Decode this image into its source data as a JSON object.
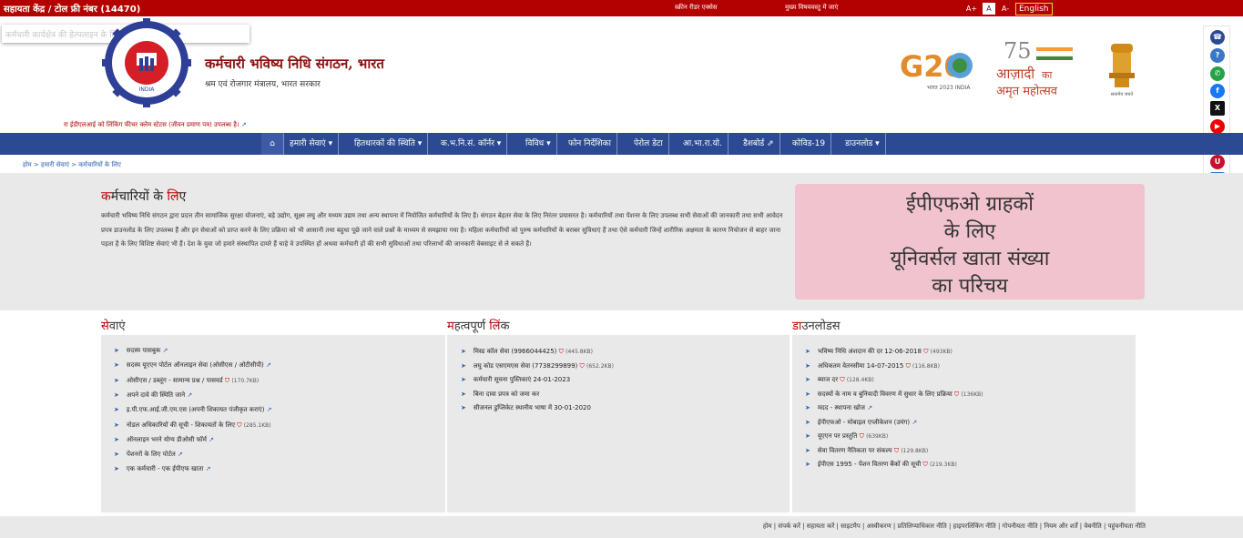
{
  "topbar": {
    "helpline": "सहायता केंद्र / टोल फ्री नंबर (14470)",
    "screen_reader": "स्क्रीन रीडर एक्सेस",
    "skip_to_main": "मुख्य विषयवस्तु में जाएं",
    "font_increase": "A+",
    "font_normal": "A",
    "font_decrease": "A-",
    "language": "English"
  },
  "header": {
    "skip_box_text": "कर्मचारी कार्यक्षेत्र की हेल्पलाइन के लिए यहाँ क्लिक करें",
    "org_title": "कर्मचारी भविष्य निधि संगठन, भारत",
    "org_subtitle": "श्रम एवं रोजगार मंत्रालय, भारत सरकार",
    "fraud_note": "रा ईडीएलआई को लिंकिंग फीचर क्लेम स्टेटस (जीवन प्रमाण पत्र) उपलब्ध है।",
    "logo_text_inner": "INDIA",
    "g20_label": "G20",
    "g20_sub": "भारत 2023 INDIA",
    "azadi_top": "75",
    "azadi_line1": "आज़ादी",
    "azadi_ka": "का",
    "azadi_line2": "अमृत महोत्सव",
    "emblem_caption": "सत्यमेव जयते"
  },
  "social": [
    "phone-icon",
    "faq-icon",
    "whatsapp-icon",
    "facebook-icon",
    "x-icon",
    "youtube-icon",
    "call-icon",
    "umang-icon",
    "document-icon",
    "app-icon",
    "instagram-icon",
    "koo-icon"
  ],
  "nav": {
    "home": "⌂",
    "items": [
      "हमारी सेवाएं ▾",
      "हितधारकों की स्थिति ▾",
      "क.भ.नि.सं. कॉर्नर ▾",
      "विविध ▾",
      "फोन निर्देशिका",
      "पेरोल डेटा",
      "आ.भा.रा.यो.",
      "डैशबोर्ड ⇗",
      "कोविड-19",
      "डाउनलोड ▾"
    ]
  },
  "breadcrumb": "होम > हमारी सेवाएं > कर्मचारियों के लिए",
  "intro": {
    "title_a": "क",
    "title_b": "र्मचारियों के ",
    "title_c": "लि",
    "title_d": "ए",
    "text": "कर्मचारी भविष्य निधि संगठन द्वारा प्रदत्त तीन सामाजिक सुरक्षा योजनाएं, बड़े उद्योग, सूक्ष्म लघु और मध्यम उद्यम तथा अन्य स्थापना में नियोजित कर्मचारियों के लिए हैं। संगठन बेहतर सेवा के लिए निरंतर प्रयासरत है। कर्मचारियों तथा पेंशनर के लिए उपलब्ध सभी सेवाओं की जानकारी तथा सभी आवेदन प्रपत्र डाउनलोड के लिए उपलब्ध हैं और इन सेवाओं को प्राप्त करने के लिए प्रक्रिया को भी आसानी तथा बहुधा पूछे जाने वाले प्रश्नों के माध्यम से समझाया गया है। महिला कर्मचारियों को पुरुष कर्मचारियों के बराबर सुविधाएं हैं तथा ऐसे कर्मचारी जिन्हें शारीरिक अक्षमता के कारण नियोजन से बाहर जाना पड़ता है के लिए विशिष्ट सेवाएं भी हैं। देश के युवा जो हमारे संस्थापित दायरे हैं चाहे वे उपस्थित हों अथवा कर्मचारी हों की सभी सुविधाओं तथा परिलाभों की जानकारी वेबसाइट से ले सकते हैं।",
    "banner_lines": [
      "ईपीएफओ ग्राहकों",
      "के लिए",
      "यूनिवर्सल खाता संख्या",
      "का परिचय"
    ]
  },
  "services": {
    "title_a": "से",
    "title_b": "वाएं",
    "items": [
      {
        "label": "सदस्य पासबुक",
        "size": "",
        "icon": "ext"
      },
      {
        "label": "सदस्य यूएएन पोर्टल ऑनलाइन सेवा (ओसीएस / ओटीसीपी)",
        "size": "",
        "icon": "ext"
      },
      {
        "label": "ओसीएस / डब्लूंग - सामान्य प्रश्न / पासवर्ड",
        "size": "(170.7KB)",
        "icon": "pdf"
      },
      {
        "label": "अपने दावे की स्थिति जाने",
        "size": "",
        "icon": "ext"
      },
      {
        "label": "इ.पी.एफ.आई.जी.एम.एस (अपनी शिकायत पंजीकृत कराएं)",
        "size": "",
        "icon": "ext"
      },
      {
        "label": "नोडल अधिकारियों की सूची - शिकायतों के लिए",
        "size": "(285.1KB)",
        "icon": "pdf"
      },
      {
        "label": "ऑनलाइन भरने योग्य डीओसी फॉर्म",
        "size": "",
        "icon": "ext"
      },
      {
        "label": "पेंशनरों के लिए पोर्टल",
        "size": "",
        "icon": "ext"
      },
      {
        "label": "एक कर्मचारी - एक ईपीएफ खाता",
        "size": "",
        "icon": "ext"
      }
    ]
  },
  "important_links": {
    "title_a": "म",
    "title_b": "हत्वपूर्ण ",
    "title_c": "लिं",
    "title_d": "क",
    "items": [
      {
        "label": "मिस्ड कॉल सेवा (9966044425)",
        "size": "(445.8KB)",
        "icon": "pdf"
      },
      {
        "label": "लघु कोड एसएमएस सेवा (7738299899)",
        "size": "(652.2KB)",
        "icon": "pdf"
      },
      {
        "label": "कर्मचारी सूचना पुस्तिकाएं 24-01-2023",
        "size": "",
        "icon": ""
      },
      {
        "label": "बिना दावा प्रपत्र को जमा कर",
        "size": "",
        "icon": ""
      },
      {
        "label": "सीजनल डुप्लिकेट स्थानीय भाषा में 30-01-2020",
        "size": "",
        "icon": ""
      }
    ]
  },
  "downloads": {
    "title_a": "डा",
    "title_b": "उनलोडस",
    "items": [
      {
        "label": "भविष्य निधि अंशदान की दर 12-06-2018",
        "size": "(493KB)",
        "icon": "pdf"
      },
      {
        "label": "अधिकतम वेतनसीमा 14-07-2015",
        "size": "(116.8KB)",
        "icon": "pdf"
      },
      {
        "label": "ब्याज दर",
        "size": "(128.4KB)",
        "icon": "pdf"
      },
      {
        "label": "सदस्यों के नाम व बुनियादी विवरण में सुधार के लिए प्रक्रिया",
        "size": "(136KB)",
        "icon": "pdf"
      },
      {
        "label": "मदद - स्थापना खोज",
        "size": "",
        "icon": "ext"
      },
      {
        "label": "ईपीएफओ - मोबाइल एप्लीकेशन (उमंग)",
        "size": "",
        "icon": "ext"
      },
      {
        "label": "यूएएन पर प्रस्तुति",
        "size": "(639KB)",
        "icon": "pdf"
      },
      {
        "label": "सेवा वितरण नैतिकता पर संकल्प",
        "size": "(129.8KB)",
        "icon": "pdf"
      },
      {
        "label": "ईपीएस 1995 - पेंशन वितरण बैंकों की सूची",
        "size": "(219.3KB)",
        "icon": "pdf"
      }
    ]
  },
  "footer": "होम | संपर्क करें | सहायता करें | साइटमैप | अस्वीकरण | प्रतिलिप्याधिकार नीति | हाइपरलिंकिंग नीति | गोपनीयता नीति | नियम और शर्तें | वेबनीति | पहुंचनीयता नीति"
}
